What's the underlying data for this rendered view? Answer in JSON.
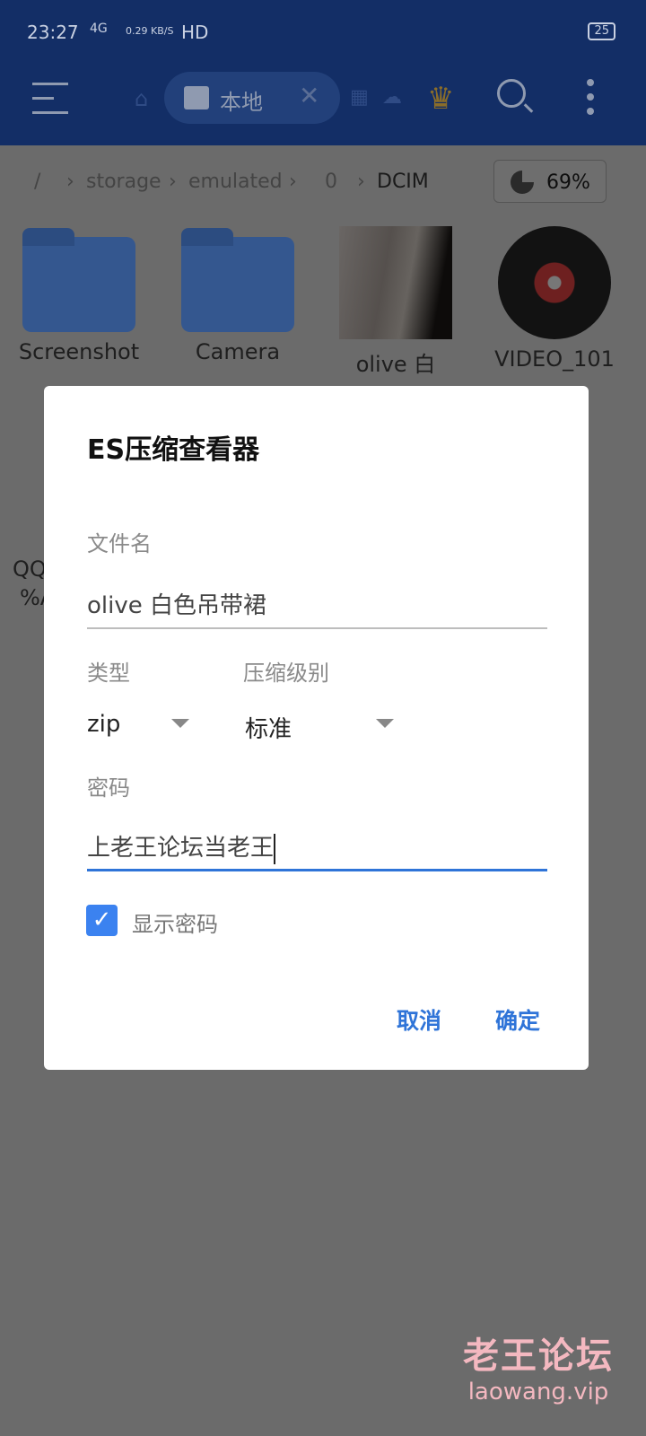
{
  "status": {
    "time": "23:27",
    "network": "4G",
    "speed": "0.29 KB/S",
    "hd": "HD",
    "battery": "25"
  },
  "toolbar": {
    "tab_label": "本地"
  },
  "breadcrumb": {
    "items": [
      "/",
      "storage",
      "emulated",
      "0",
      "DCIM"
    ],
    "storage_percent": "69%"
  },
  "files": [
    {
      "name": "Screenshot",
      "type": "folder"
    },
    {
      "name": "Camera",
      "type": "folder"
    },
    {
      "name": "olive 白",
      "type": "image"
    },
    {
      "name": "VIDEO_101",
      "type": "video"
    }
  ],
  "partial_file": {
    "line1": "QQ",
    "line2": "%A"
  },
  "dialog": {
    "title": "ES压缩查看器",
    "filename_label": "文件名",
    "filename_value": "olive  白色吊带裙",
    "type_label": "类型",
    "type_value": "zip",
    "level_label": "压缩级别",
    "level_value": "标准",
    "password_label": "密码",
    "password_value": "上老王论坛当老王",
    "show_password_label": "显示密码",
    "show_password_checked": true,
    "cancel": "取消",
    "ok": "确定",
    "accent": "#2f74d8"
  },
  "watermark": {
    "cn": "老王论坛",
    "url": "laowang.vip"
  }
}
